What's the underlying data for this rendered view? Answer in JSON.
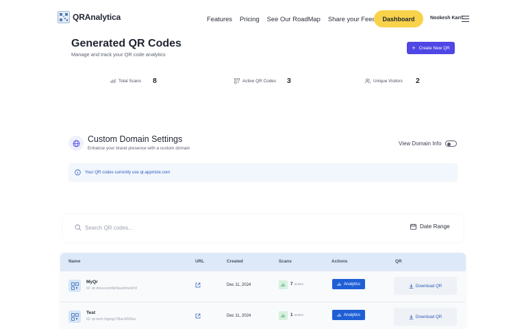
{
  "header": {
    "brand": "QRAnalytica",
    "nav": [
      "Features",
      "Pricing",
      "See Our RoadMap",
      "Share your Feedback"
    ],
    "dashboard_label": "Dashboard",
    "user_name": "Nookesh Karri"
  },
  "page": {
    "title": "Generated QR Codes",
    "subtitle": "Manage and track your QR code analytics",
    "create_label": "Create New QR"
  },
  "stats": [
    {
      "label": "Total Scans",
      "value": "8",
      "icon": "bar-chart-icon"
    },
    {
      "label": "Active QR Codes",
      "value": "3",
      "icon": "qr-code-icon"
    },
    {
      "label": "Unique Visitors",
      "value": "2",
      "icon": "users-icon"
    }
  ],
  "domain": {
    "title": "Custom Domain Settings",
    "subtitle": "Enhance your brand presence with a custom domain",
    "view_info_label": "View Domain Info",
    "toggle_on": false,
    "notice": "Your QR codes currently use qr.appmize.com"
  },
  "search": {
    "placeholder": "Search QR codes...",
    "date_range_label": "Date Range"
  },
  "table": {
    "columns": [
      "Name",
      "URL",
      "Created",
      "Scans",
      "Actions",
      "QR"
    ],
    "rows": [
      {
        "name": "MyQr",
        "id": "ID: qr-dsnui-xon9jc5wa0mwol7d",
        "created": "Dec 11, 2024",
        "scans": "7",
        "scans_unit": "scans",
        "action": "Analytics",
        "download": "Download QR"
      },
      {
        "name": "Test",
        "id": "ID: qr-tech-3qpngr73ba-0t5l3us",
        "created": "Dec 11, 2024",
        "scans": "1",
        "scans_unit": "scans",
        "action": "Analytics",
        "download": "Download QR"
      }
    ]
  },
  "colors": {
    "accent": "#4f46e5",
    "dashboard": "#f8d24a",
    "analytics_button": "#1f5fd6",
    "notice_bg": "#f2f6fd",
    "table_header": "#dde8f8"
  }
}
